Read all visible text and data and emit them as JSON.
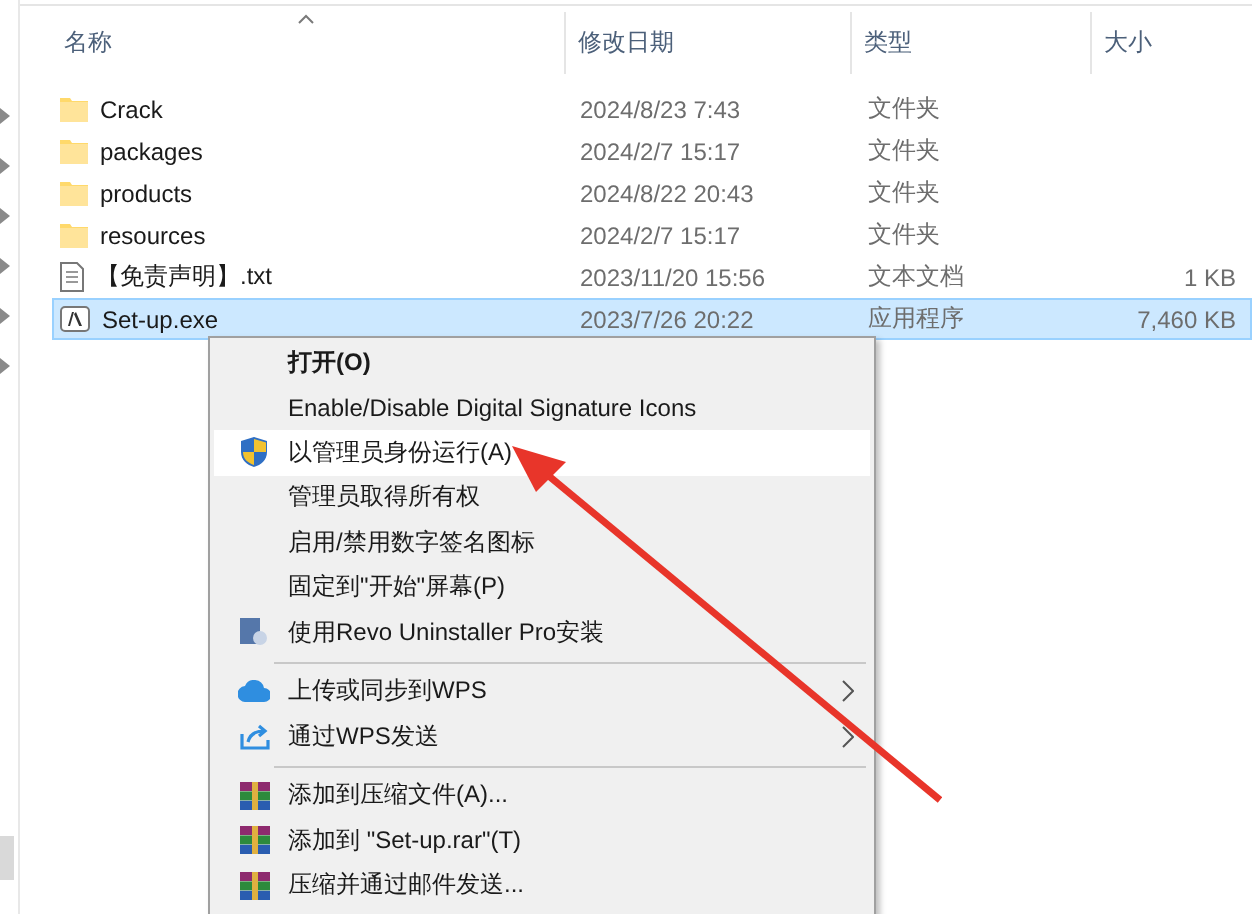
{
  "columns": [
    {
      "label": "名称",
      "sorted": true
    },
    {
      "label": "修改日期",
      "sorted": false
    },
    {
      "label": "类型",
      "sorted": false
    },
    {
      "label": "大小",
      "sorted": false
    }
  ],
  "files": [
    {
      "name": "Crack",
      "modified": "2024/8/23 7:43",
      "type": "文件夹",
      "kind": "folder",
      "selected": false
    },
    {
      "name": "packages",
      "modified": "2024/2/7 15:17",
      "type": "文件夹",
      "kind": "folder",
      "selected": false
    },
    {
      "name": "products",
      "modified": "2024/8/22 20:43",
      "type": "文件夹",
      "kind": "folder",
      "selected": false
    },
    {
      "name": "resources",
      "modified": "2024/2/7 15:17",
      "type": "文件夹",
      "kind": "folder",
      "selected": false
    },
    {
      "name": "【免责声明】.txt",
      "modified": "2023/11/20 15:56",
      "type": "文本文档",
      "size": "1 KB",
      "kind": "text",
      "selected": false
    },
    {
      "name": "Set-up.exe",
      "modified": "2023/7/26 20:22",
      "type": "应用程序",
      "size": "7,460 KB",
      "kind": "exe",
      "selected": true
    }
  ],
  "context_menu": {
    "items": [
      {
        "kind": "plain",
        "label": "打开(O)",
        "default": true,
        "selected": false,
        "submenu": false
      },
      {
        "kind": "plain",
        "label": "Enable/Disable Digital Signature Icons",
        "default": false,
        "selected": false,
        "submenu": false
      },
      {
        "kind": "shield",
        "label": "以管理员身份运行(A)",
        "default": false,
        "selected": true,
        "submenu": false
      },
      {
        "kind": "plain",
        "label": "管理员取得所有权",
        "default": false,
        "selected": false,
        "submenu": false
      },
      {
        "kind": "plain",
        "label": "启用/禁用数字签名图标",
        "default": false,
        "selected": false,
        "submenu": false
      },
      {
        "kind": "plain",
        "label": "固定到\"开始\"屏幕(P)",
        "default": false,
        "selected": false,
        "submenu": false
      },
      {
        "kind": "installer",
        "label": "使用Revo Uninstaller Pro安装",
        "default": false,
        "selected": false,
        "submenu": false
      },
      {
        "kind": "separator"
      },
      {
        "kind": "cloud",
        "label": "上传或同步到WPS",
        "default": false,
        "selected": false,
        "submenu": true
      },
      {
        "kind": "share",
        "label": "通过WPS发送",
        "default": false,
        "selected": false,
        "submenu": true
      },
      {
        "kind": "separator"
      },
      {
        "kind": "archive",
        "label": "添加到压缩文件(A)...",
        "default": false,
        "selected": false,
        "submenu": false
      },
      {
        "kind": "archive",
        "label": "添加到 \"Set-up.rar\"(T)",
        "default": false,
        "selected": false,
        "submenu": false
      },
      {
        "kind": "archive",
        "label": "压缩并通过邮件发送...",
        "default": false,
        "selected": false,
        "submenu": false
      }
    ]
  }
}
